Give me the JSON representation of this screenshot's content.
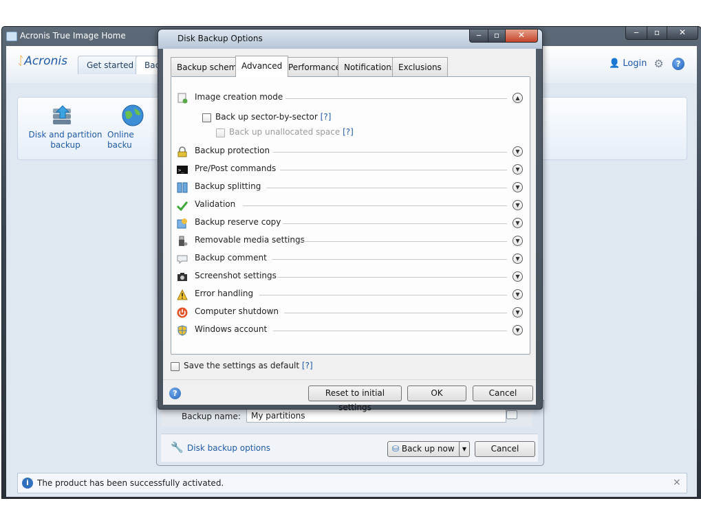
{
  "main_window": {
    "title": "Acronis True Image Home",
    "caption_buttons": {
      "minimize": "‒",
      "maximize": "▫",
      "close": "✕"
    },
    "logo": "Acronis",
    "tabs": [
      {
        "label": "Get started"
      },
      {
        "label": "Back"
      }
    ],
    "login_label": "Login",
    "ribbon": {
      "items": [
        {
          "label_line1": "Disk and partition",
          "label_line2": "backup"
        },
        {
          "label_line1": "Online backu",
          "label_line2": ""
        }
      ]
    },
    "status_bar": {
      "message": "The product has been successfully activated.",
      "close": "×"
    }
  },
  "backup_dialog": {
    "backup_name_label": "Backup name:",
    "backup_name_value": "My partitions",
    "options_link": "Disk backup options",
    "back_up_now": "Back up now",
    "cancel": "Cancel"
  },
  "options_dialog": {
    "title": "Disk Backup Options",
    "caption_buttons": {
      "minimize": "‒",
      "maximize": "▫",
      "close": "✕"
    },
    "tabs": [
      {
        "label": "Backup scheme",
        "active": false
      },
      {
        "label": "Advanced",
        "active": true
      },
      {
        "label": "Performance",
        "active": false
      },
      {
        "label": "Notifications",
        "active": false
      },
      {
        "label": "Exclusions",
        "active": false
      }
    ],
    "image_creation": {
      "label": "Image creation mode",
      "expanded": true,
      "sector_by_sector": {
        "label": "Back up sector-by-sector",
        "help": "[?]",
        "checked": false
      },
      "unallocated": {
        "label": "Back up unallocated space",
        "help": "[?]",
        "checked": false,
        "enabled": false
      }
    },
    "sections": [
      {
        "label": "Backup protection",
        "icon": "lock-icon"
      },
      {
        "label": "Pre/Post commands",
        "icon": "console-icon"
      },
      {
        "label": "Backup splitting",
        "icon": "split-icon"
      },
      {
        "label": "Validation",
        "icon": "checkmark-icon"
      },
      {
        "label": "Backup reserve copy",
        "icon": "copy-icon"
      },
      {
        "label": "Removable media settings",
        "icon": "usb-icon"
      },
      {
        "label": "Backup comment",
        "icon": "comment-icon"
      },
      {
        "label": "Screenshot settings",
        "icon": "camera-icon"
      },
      {
        "label": "Error handling",
        "icon": "warning-icon"
      },
      {
        "label": "Computer shutdown",
        "icon": "power-icon"
      },
      {
        "label": "Windows account",
        "icon": "shield-icon"
      }
    ],
    "save_default": {
      "label": "Save the settings as default",
      "help": "[?]",
      "checked": false
    },
    "buttons": {
      "reset": "Reset to initial settings",
      "ok": "OK",
      "cancel": "Cancel"
    }
  }
}
